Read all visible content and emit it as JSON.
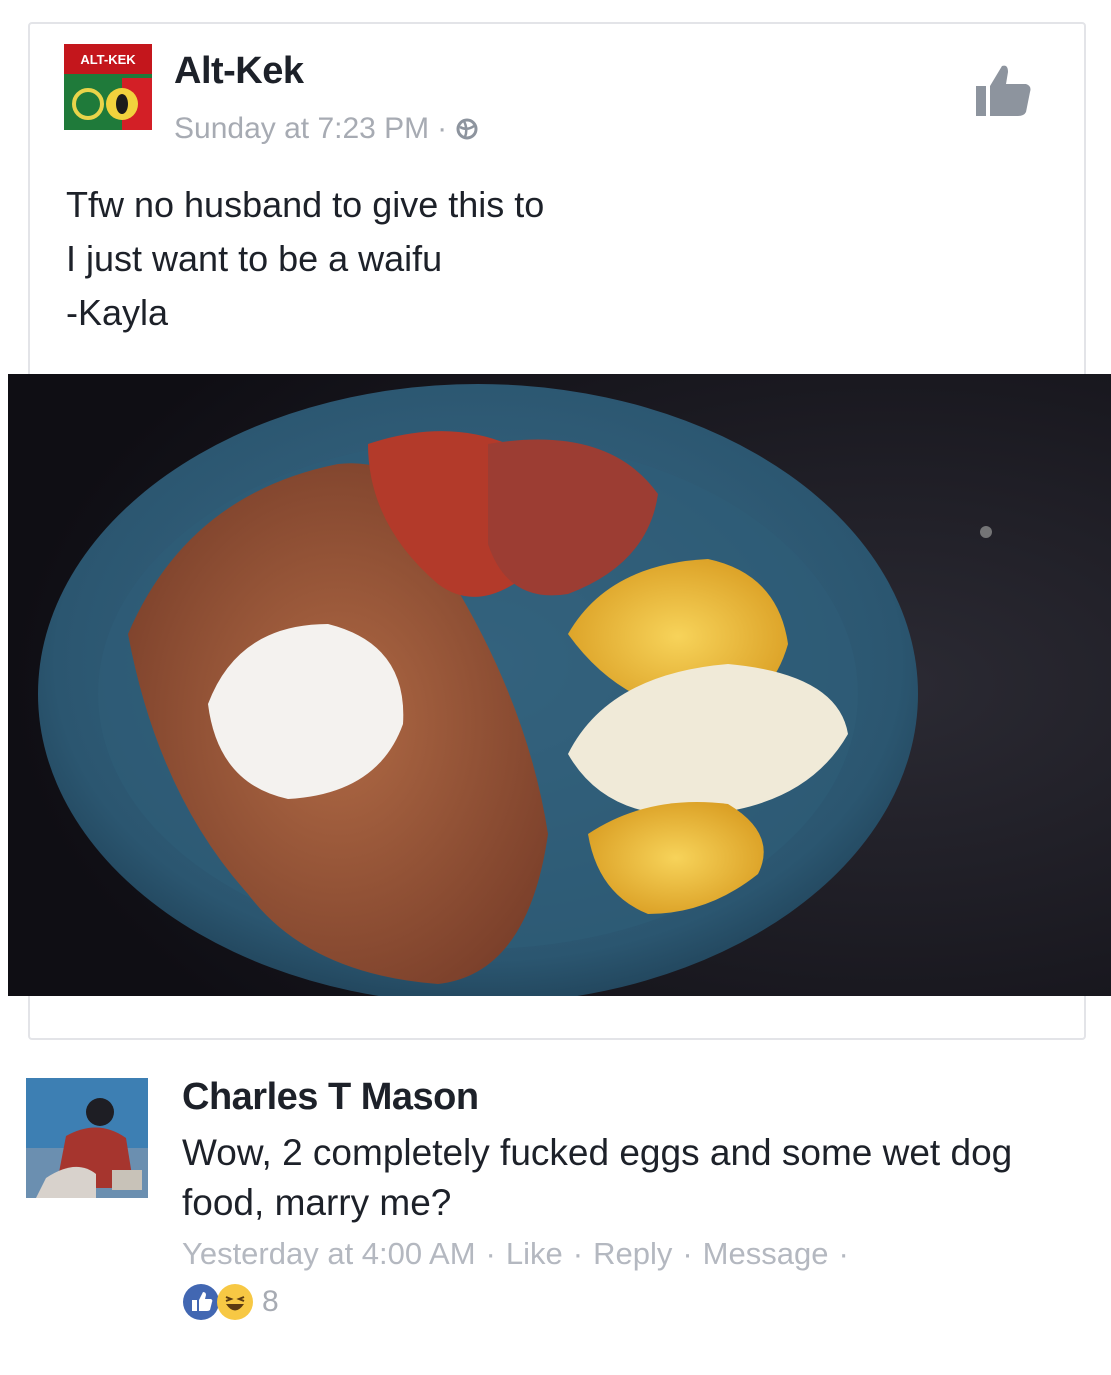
{
  "post": {
    "author": "Alt-Kek",
    "timestamp": "Sunday at 7:23 PM",
    "meta_separator": "·",
    "privacy_icon": "globe-icon",
    "text_lines": [
      "Tfw no husband to give this to",
      "I just want to be a waifu",
      "-Kayla"
    ],
    "like_page_icon": "thumbs-up-icon",
    "avatar_label": "ALT-KEK"
  },
  "comment": {
    "author": "Charles T Mason",
    "text": "Wow, 2 completely fucked eggs and some wet dog food, marry me?",
    "timestamp": "Yesterday at 4:00 AM",
    "actions": [
      "Like",
      "Reply",
      "Message"
    ],
    "separator": "·",
    "reactions": {
      "icons": [
        "like-reaction-icon",
        "haha-reaction-icon"
      ],
      "count": "8"
    }
  },
  "colors": {
    "like_blue": "#4267b2",
    "haha_yellow": "#f7c844",
    "meta_gray": "#a7abb3"
  }
}
